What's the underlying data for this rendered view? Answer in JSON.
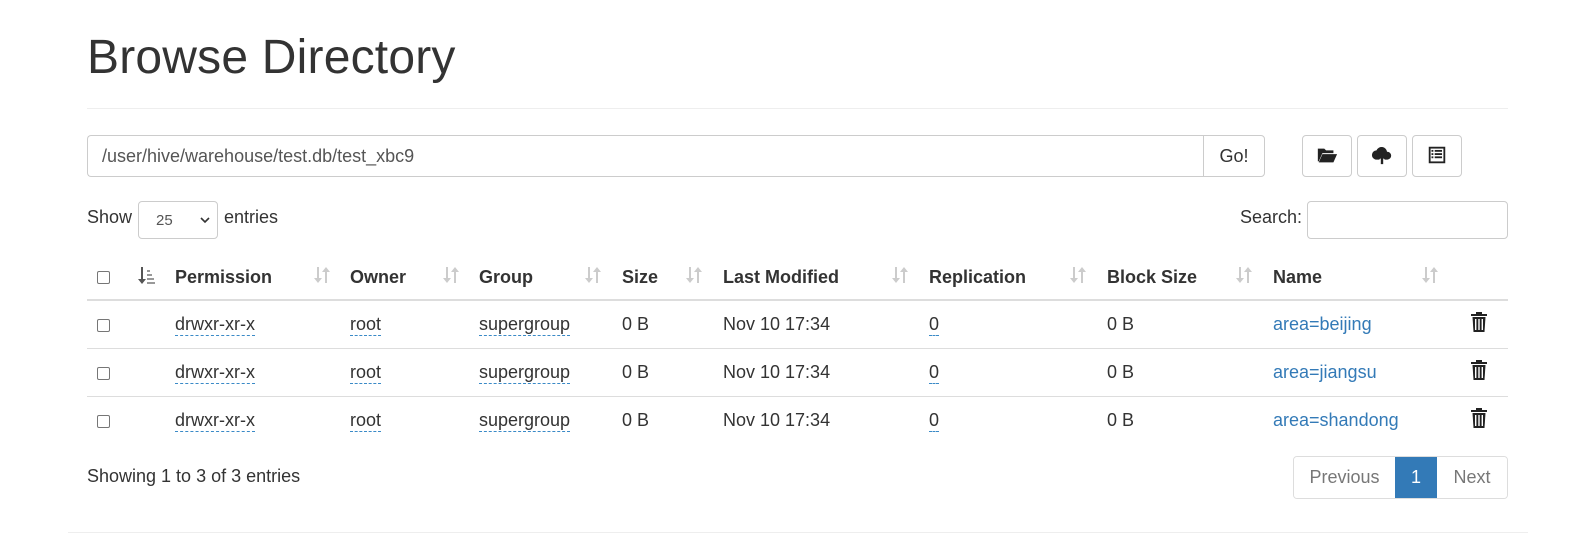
{
  "page": {
    "title": "Browse Directory"
  },
  "path_bar": {
    "value": "/user/hive/warehouse/test.db/test_xbc9",
    "go_label": "Go!"
  },
  "toolbar": {
    "buttons": [
      {
        "name": "create-directory",
        "icon": "folder-open-icon"
      },
      {
        "name": "upload-file",
        "icon": "cloud-upload-icon"
      },
      {
        "name": "cut-paste",
        "icon": "list-alt-icon"
      }
    ]
  },
  "length_control": {
    "show_label": "Show",
    "selected": "25",
    "entries_label": "entries"
  },
  "search": {
    "label": "Search:",
    "value": ""
  },
  "table": {
    "columns": [
      "Permission",
      "Owner",
      "Group",
      "Size",
      "Last Modified",
      "Replication",
      "Block Size",
      "Name"
    ],
    "rows": [
      {
        "permission": "drwxr-xr-x",
        "owner": "root",
        "group": "supergroup",
        "size": "0 B",
        "last_modified": "Nov 10 17:34",
        "replication": "0",
        "block_size": "0 B",
        "name": "area=beijing"
      },
      {
        "permission": "drwxr-xr-x",
        "owner": "root",
        "group": "supergroup",
        "size": "0 B",
        "last_modified": "Nov 10 17:34",
        "replication": "0",
        "block_size": "0 B",
        "name": "area=jiangsu"
      },
      {
        "permission": "drwxr-xr-x",
        "owner": "root",
        "group": "supergroup",
        "size": "0 B",
        "last_modified": "Nov 10 17:34",
        "replication": "0",
        "block_size": "0 B",
        "name": "area=shandong"
      }
    ]
  },
  "footer": {
    "info": "Showing 1 to 3 of 3 entries",
    "pagination": {
      "previous": "Previous",
      "current": "1",
      "next": "Next"
    }
  },
  "colors": {
    "link": "#337ab7",
    "active_page": "#337ab7",
    "border": "#dddddd"
  }
}
